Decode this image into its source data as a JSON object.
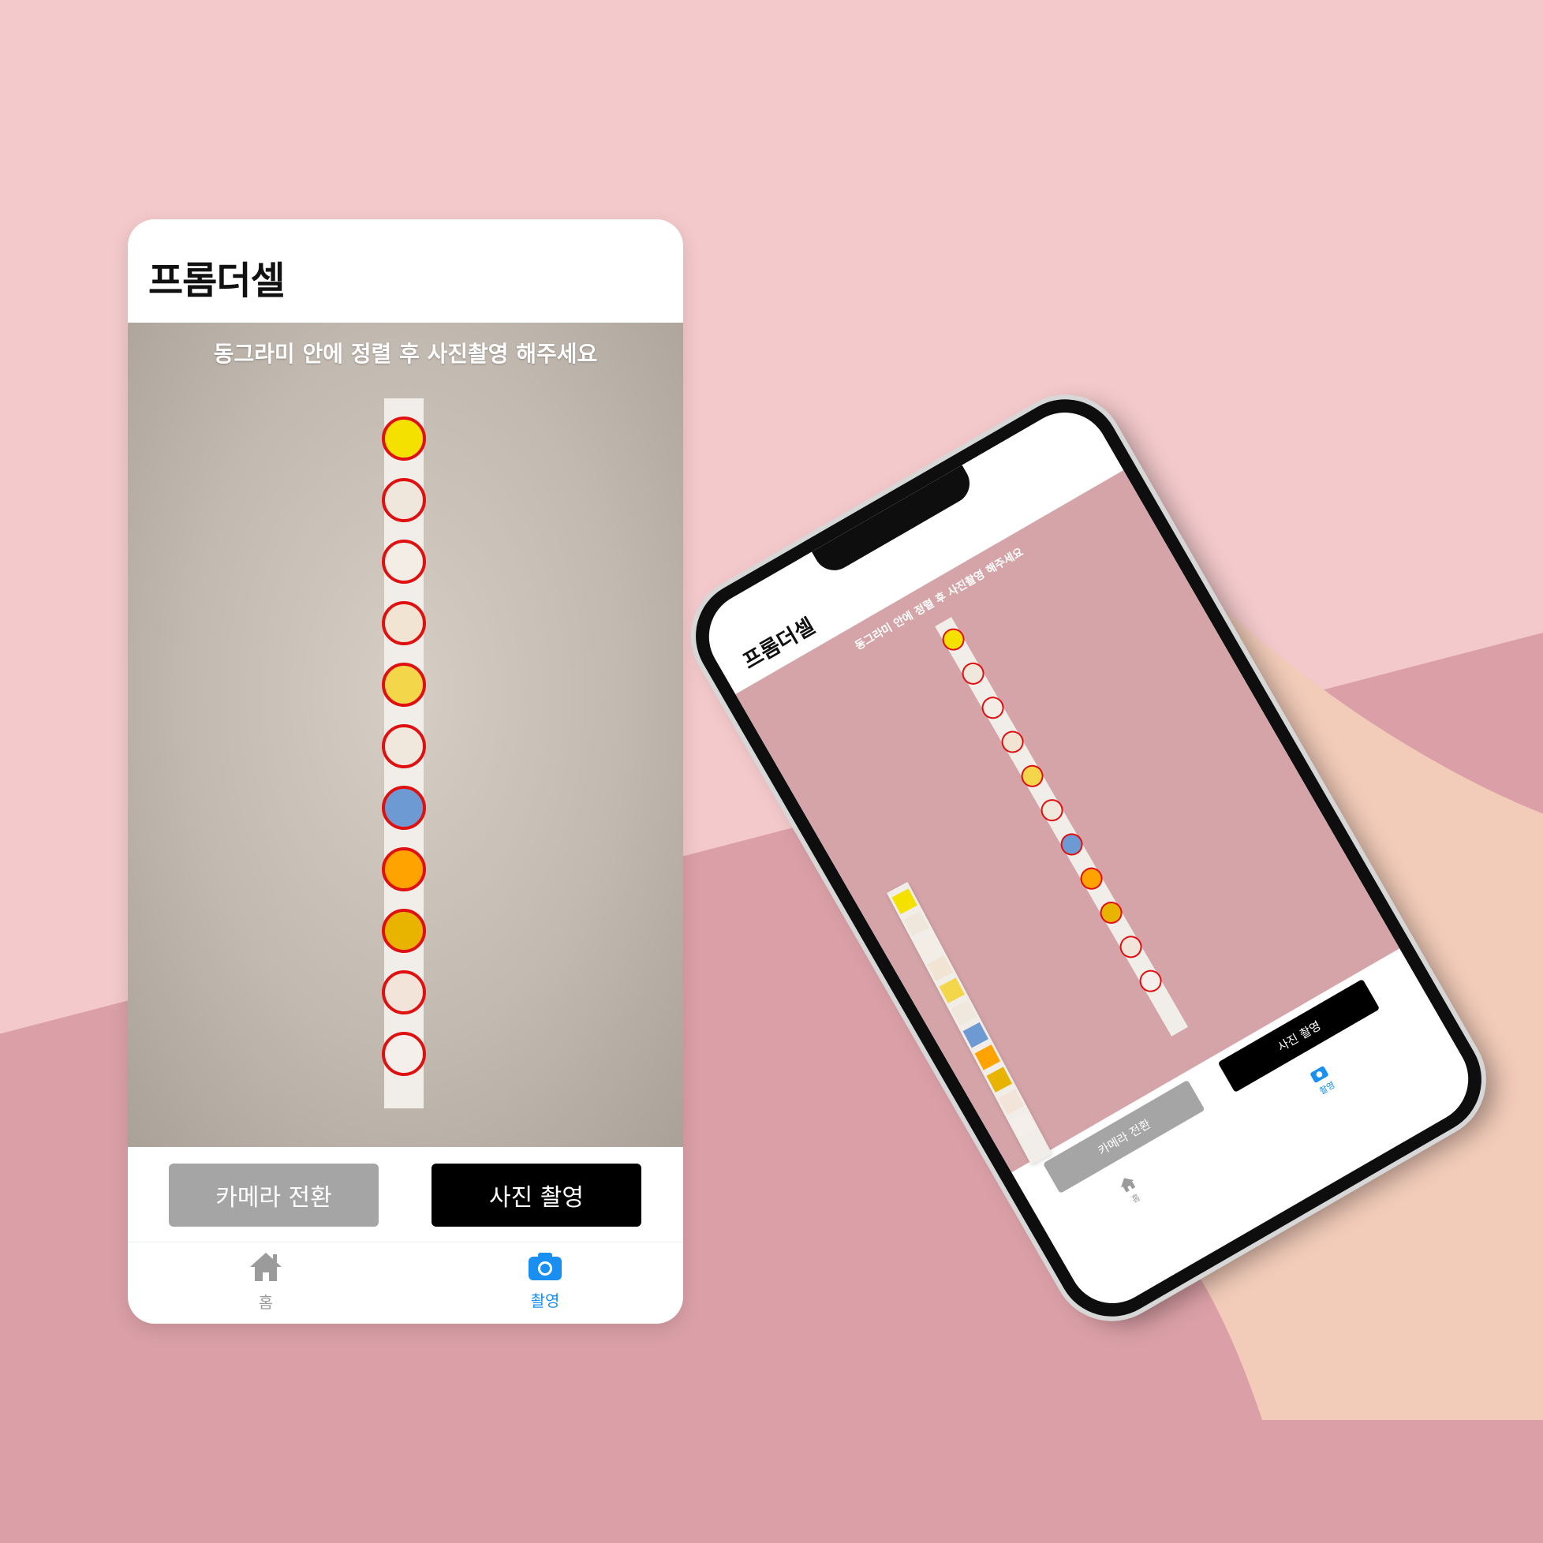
{
  "app": {
    "title": "프롬더셀"
  },
  "camera": {
    "hint": "동그라미 안에 정렬 후 사진촬영 해주세요"
  },
  "pads": [
    {
      "color": "#f5e100"
    },
    {
      "color": "#efe7db"
    },
    {
      "color": "#f3ede6"
    },
    {
      "color": "#f1e4d2"
    },
    {
      "color": "#f3d64a"
    },
    {
      "color": "#f0e8dc"
    },
    {
      "color": "#6e9ad4"
    },
    {
      "color": "#ffa300"
    },
    {
      "color": "#e8b400"
    },
    {
      "color": "#f2e4d8"
    },
    {
      "color": "#f4efeb"
    }
  ],
  "buttons": {
    "switch_camera": "카메라 전환",
    "take_photo": "사진 촬영"
  },
  "tabs": [
    {
      "label": "홈",
      "icon": "home-icon",
      "active": false
    },
    {
      "label": "촬영",
      "icon": "camera-icon",
      "active": true
    }
  ],
  "colors": {
    "accent": "#1a8ff2",
    "pad_ring": "#e01010",
    "switch_button": "#a5a5a5",
    "shoot_button": "#000000"
  }
}
